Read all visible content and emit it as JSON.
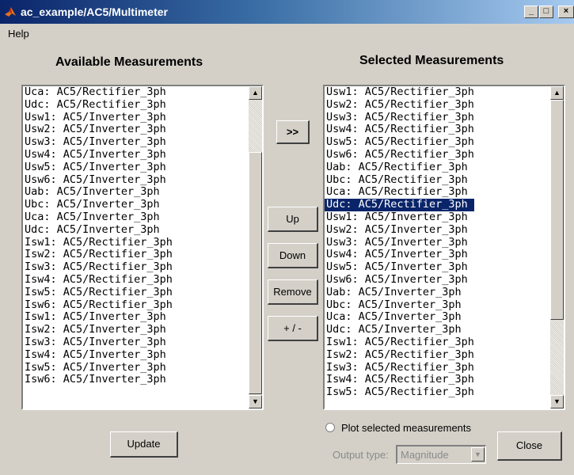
{
  "window": {
    "title": "ac_example/AC5/Multimeter",
    "minimize": "_",
    "maximize": "□",
    "close": "×"
  },
  "menu": {
    "help": "Help"
  },
  "available": {
    "heading": "Available Measurements",
    "items": [
      "Uca: AC5/Rectifier_3ph",
      "Udc: AC5/Rectifier_3ph",
      "Usw1: AC5/Inverter_3ph",
      "Usw2: AC5/Inverter_3ph",
      "Usw3: AC5/Inverter_3ph",
      "Usw4: AC5/Inverter_3ph",
      "Usw5: AC5/Inverter_3ph",
      "Usw6: AC5/Inverter_3ph",
      "Uab: AC5/Inverter_3ph",
      "Ubc: AC5/Inverter_3ph",
      "Uca: AC5/Inverter_3ph",
      "Udc: AC5/Inverter_3ph",
      "Isw1: AC5/Rectifier_3ph",
      "Isw2: AC5/Rectifier_3ph",
      "Isw3: AC5/Rectifier_3ph",
      "Isw4: AC5/Rectifier_3ph",
      "Isw5: AC5/Rectifier_3ph",
      "Isw6: AC5/Rectifier_3ph",
      "Isw1: AC5/Inverter_3ph",
      "Isw2: AC5/Inverter_3ph",
      "Isw3: AC5/Inverter_3ph",
      "Isw4: AC5/Inverter_3ph",
      "Isw5: AC5/Inverter_3ph",
      "Isw6: AC5/Inverter_3ph"
    ]
  },
  "selected": {
    "heading": "Selected Measurements",
    "selected_index": 9,
    "items": [
      "Usw1: AC5/Rectifier_3ph",
      "Usw2: AC5/Rectifier_3ph",
      "Usw3: AC5/Rectifier_3ph",
      "Usw4: AC5/Rectifier_3ph",
      "Usw5: AC5/Rectifier_3ph",
      "Usw6: AC5/Rectifier_3ph",
      "Uab: AC5/Rectifier_3ph",
      "Ubc: AC5/Rectifier_3ph",
      "Uca: AC5/Rectifier_3ph",
      "Udc: AC5/Rectifier_3ph",
      "Usw1: AC5/Inverter_3ph",
      "Usw2: AC5/Inverter_3ph",
      "Usw3: AC5/Inverter_3ph",
      "Usw4: AC5/Inverter_3ph",
      "Usw5: AC5/Inverter_3ph",
      "Usw6: AC5/Inverter_3ph",
      "Uab: AC5/Inverter_3ph",
      "Ubc: AC5/Inverter_3ph",
      "Uca: AC5/Inverter_3ph",
      "Udc: AC5/Inverter_3ph",
      "Isw1: AC5/Rectifier_3ph",
      "Isw2: AC5/Rectifier_3ph",
      "Isw3: AC5/Rectifier_3ph",
      "Isw4: AC5/Rectifier_3ph",
      "Isw5: AC5/Rectifier_3ph"
    ]
  },
  "buttons": {
    "add": ">>",
    "up": "Up",
    "down": "Down",
    "remove": "Remove",
    "sign": "+ / -",
    "update": "Update",
    "close": "Close"
  },
  "plot": {
    "label": "Plot selected measurements",
    "output_label": "Output type:",
    "output_value": "Magnitude"
  },
  "icons": {
    "app": "matlab-icon",
    "scroll_up": "arrow-up-icon",
    "scroll_down": "arrow-down-icon",
    "dropdown": "chevron-down-icon"
  },
  "colors": {
    "title_bar": "#0a246a",
    "selection": "#0a246a",
    "window_bg": "#d4d0c8"
  }
}
